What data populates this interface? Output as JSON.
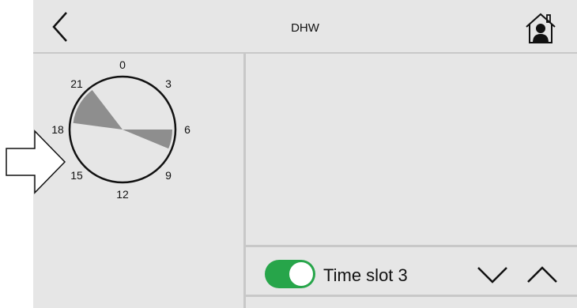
{
  "header": {
    "title": "DHW",
    "back_icon": "chevron-left-icon",
    "home_icon": "house-person-icon"
  },
  "dial": {
    "hour_labels": [
      "0",
      "3",
      "6",
      "9",
      "12",
      "15",
      "18",
      "21"
    ],
    "active_ranges_hours": [
      [
        18.5,
        21.5
      ],
      [
        6.0,
        7.5
      ]
    ],
    "fill_color": "#8e8e8e"
  },
  "slot": {
    "toggle_on": true,
    "toggle_color": "#27a54a",
    "label": "Time slot 3",
    "down_icon": "chevron-down-icon",
    "up_icon": "chevron-up-icon"
  },
  "indicator_icon": "arrow-right-outline-icon"
}
